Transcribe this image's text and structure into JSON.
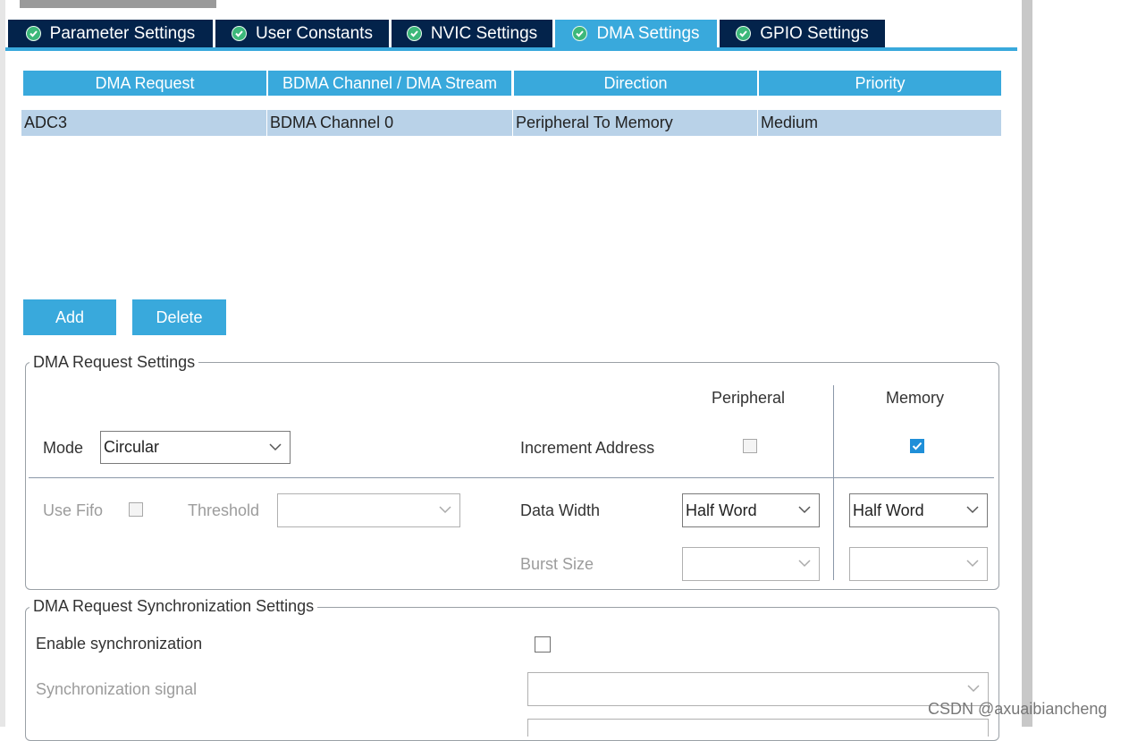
{
  "tabs": [
    {
      "label": "Parameter Settings",
      "active": false
    },
    {
      "label": "User Constants",
      "active": false
    },
    {
      "label": "NVIC Settings",
      "active": false
    },
    {
      "label": "DMA Settings",
      "active": true
    },
    {
      "label": "GPIO Settings",
      "active": false
    }
  ],
  "table": {
    "headers": [
      "DMA Request",
      "BDMA Channel / DMA Stream",
      "Direction",
      "Priority"
    ],
    "rows": [
      [
        "ADC3",
        "BDMA Channel 0",
        "Peripheral To Memory",
        "Medium"
      ]
    ]
  },
  "buttons": {
    "add": "Add",
    "delete": "Delete"
  },
  "request_settings": {
    "legend": "DMA Request Settings",
    "peripheral_header": "Peripheral",
    "memory_header": "Memory",
    "mode_label": "Mode",
    "mode_value": "Circular",
    "increment_label": "Increment Address",
    "increment_peripheral": false,
    "increment_memory": true,
    "use_fifo_label": "Use Fifo",
    "use_fifo": false,
    "threshold_label": "Threshold",
    "threshold_value": "",
    "data_width_label": "Data Width",
    "data_width_peripheral": "Half Word",
    "data_width_memory": "Half Word",
    "burst_size_label": "Burst Size",
    "burst_peripheral": "",
    "burst_memory": ""
  },
  "sync_settings": {
    "legend": "DMA Request Synchronization Settings",
    "enable_label": "Enable synchronization",
    "enable_value": false,
    "signal_label": "Synchronization signal",
    "signal_value": ""
  },
  "watermark": "CSDN @axuaibiancheng",
  "colors": {
    "tab_bg": "#03234b",
    "accent": "#39a9dc",
    "row_bg": "#b9d2e8",
    "check_green": "#3cb87a"
  }
}
